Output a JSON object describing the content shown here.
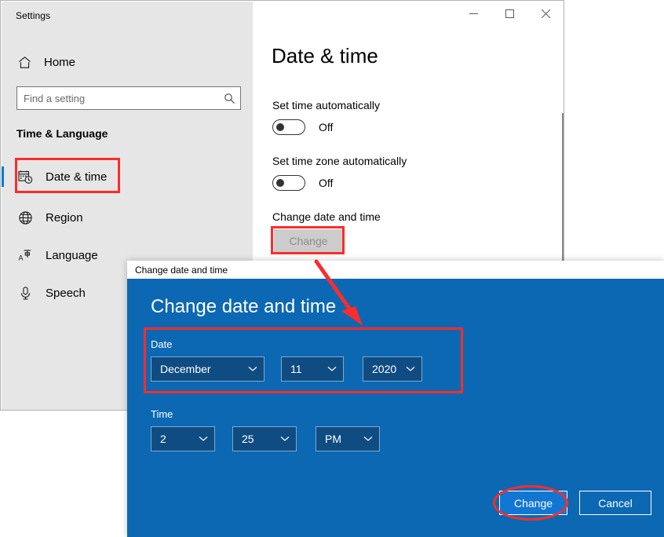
{
  "settings_window": {
    "app_title": "Settings",
    "window_controls": [
      {
        "name": "minimize",
        "glyph": "minimize-icon"
      },
      {
        "name": "maximize",
        "glyph": "maximize-icon"
      },
      {
        "name": "close",
        "glyph": "close-icon"
      }
    ],
    "sidebar": {
      "home_label": "Home",
      "home_icon": "home-icon",
      "search": {
        "placeholder": "Find a setting",
        "value": "",
        "icon": "search-icon"
      },
      "group_title": "Time & Language",
      "items": [
        {
          "label": "Date & time",
          "icon": "calendar-clock-icon",
          "selected": true
        },
        {
          "label": "Region",
          "icon": "globe-icon",
          "selected": false
        },
        {
          "label": "Language",
          "icon": "language-icon",
          "selected": false
        },
        {
          "label": "Speech",
          "icon": "microphone-icon",
          "selected": false
        }
      ]
    },
    "main": {
      "page_title": "Date & time",
      "set_time_automatically": {
        "label": "Set time automatically",
        "state": "Off",
        "checked": false
      },
      "set_timezone_automatically": {
        "label": "Set time zone automatically",
        "state": "Off",
        "checked": false
      },
      "change_date_and_time": {
        "label": "Change date and time",
        "button_label": "Change",
        "disabled": true
      }
    }
  },
  "dialog": {
    "titlebar_text": "Change date and time",
    "heading": "Change date and time",
    "date": {
      "group_label": "Date",
      "month": "December",
      "day": "11",
      "year": "2020"
    },
    "time": {
      "group_label": "Time",
      "hour": "2",
      "minute": "25",
      "meridiem": "PM"
    },
    "buttons": {
      "confirm": "Change",
      "cancel": "Cancel"
    }
  },
  "annotations": {
    "highlight_color": "#fb2c2c",
    "arrow": "red-arrow-pointing-to-date-section",
    "ellipse": "red-ellipse-around-change-button"
  }
}
